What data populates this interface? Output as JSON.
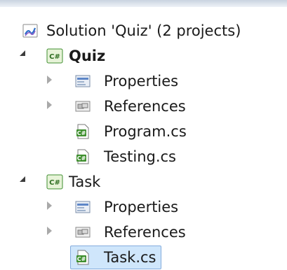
{
  "tree": {
    "solution": {
      "label": "Solution 'Quiz' (2 projects)",
      "icon": "solution-icon"
    },
    "projects": [
      {
        "label": "Quiz",
        "icon": "csharp-project-icon",
        "expanded": true,
        "items": [
          {
            "label": "Properties",
            "icon": "properties-icon",
            "expandable": true
          },
          {
            "label": "References",
            "icon": "references-icon",
            "expandable": true
          },
          {
            "label": "Program.cs",
            "icon": "csharp-file-icon",
            "expandable": false
          },
          {
            "label": "Testing.cs",
            "icon": "csharp-file-icon",
            "expandable": false
          }
        ]
      },
      {
        "label": "Task",
        "icon": "csharp-project-icon",
        "expanded": true,
        "items": [
          {
            "label": "Properties",
            "icon": "properties-icon",
            "expandable": true
          },
          {
            "label": "References",
            "icon": "references-icon",
            "expandable": true
          },
          {
            "label": "Task.cs",
            "icon": "csharp-file-icon",
            "expandable": false,
            "selected": true
          }
        ]
      }
    ]
  },
  "colors": {
    "selection_fill": "#cfe6fb",
    "selection_border": "#84acdd",
    "csharp_green": "#3f8f2f"
  }
}
